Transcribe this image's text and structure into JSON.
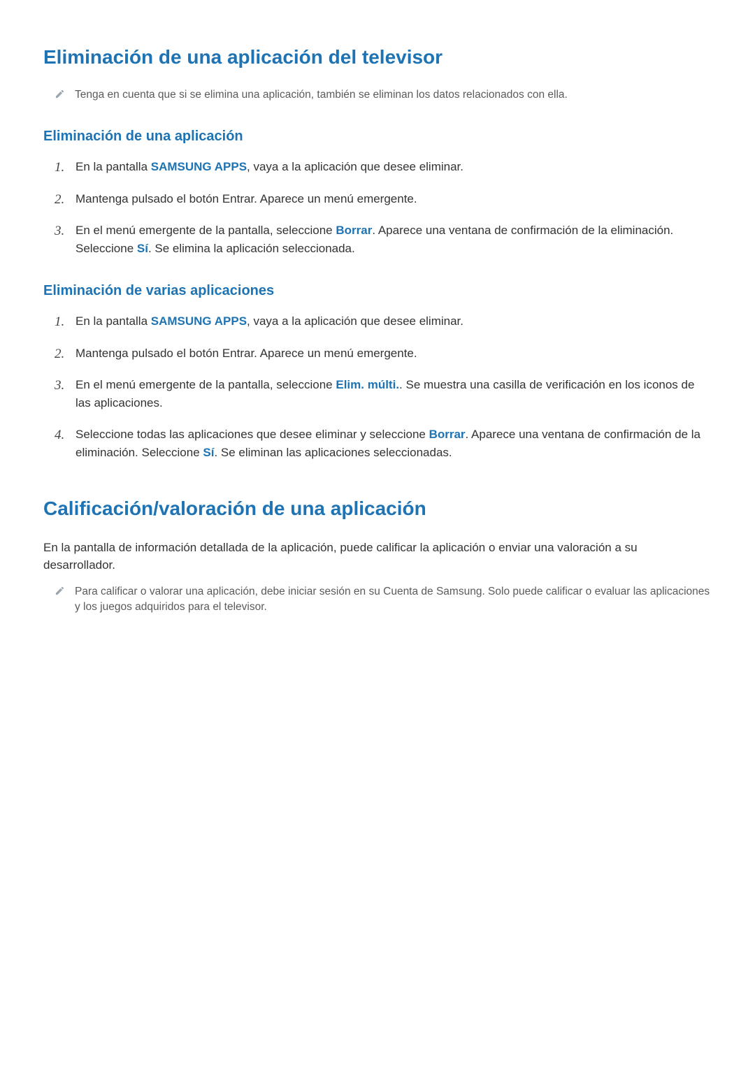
{
  "section1": {
    "title": "Eliminación de una aplicación del televisor",
    "note": "Tenga en cuenta que si se elimina una aplicación, también se eliminan los datos relacionados con ella.",
    "sub1": {
      "title": "Eliminación de una aplicación",
      "step1_a": "En la pantalla ",
      "step1_b": "SAMSUNG APPS",
      "step1_c": ", vaya a la aplicación que desee eliminar.",
      "step2": "Mantenga pulsado el botón Entrar. Aparece un menú emergente.",
      "step3_a": "En el menú emergente de la pantalla, seleccione ",
      "step3_b": "Borrar",
      "step3_c": ". Aparece una ventana de confirmación de la eliminación. Seleccione ",
      "step3_d": "Sí",
      "step3_e": ". Se elimina la aplicación seleccionada."
    },
    "sub2": {
      "title": "Eliminación de varias aplicaciones",
      "step1_a": "En la pantalla ",
      "step1_b": "SAMSUNG APPS",
      "step1_c": ", vaya a la aplicación que desee eliminar.",
      "step2": "Mantenga pulsado el botón Entrar. Aparece un menú emergente.",
      "step3_a": "En el menú emergente de la pantalla, seleccione ",
      "step3_b": "Elim. múlti.",
      "step3_c": ". Se muestra una casilla de verificación en los iconos de las aplicaciones.",
      "step4_a": "Seleccione todas las aplicaciones que desee eliminar y seleccione ",
      "step4_b": "Borrar",
      "step4_c": ". Aparece una ventana de confirmación de la eliminación. Seleccione ",
      "step4_d": "Sí",
      "step4_e": ". Se eliminan las aplicaciones seleccionadas."
    }
  },
  "section2": {
    "title": "Calificación/valoración de una aplicación",
    "paragraph": "En la pantalla de información detallada de la aplicación, puede calificar la aplicación o enviar una valoración a su desarrollador.",
    "note": "Para calificar o valorar una aplicación, debe iniciar sesión en su Cuenta de Samsung. Solo puede calificar o evaluar las aplicaciones y los juegos adquiridos para el televisor."
  }
}
